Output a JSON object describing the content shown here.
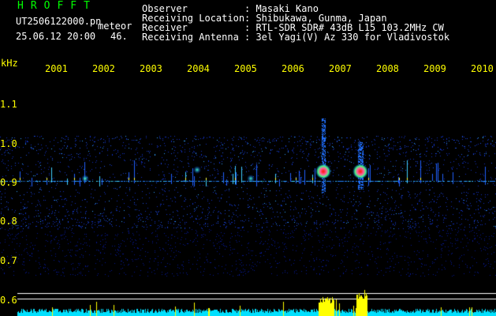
{
  "header": {
    "brand": "HROFFT",
    "filename": "UT2506122000.pn",
    "mode": "meteor",
    "datetime": "25.06.12 20:00",
    "count": "46.",
    "info": [
      {
        "label": "Observer",
        "value": ": Masaki Kano"
      },
      {
        "label": "Receiving Location",
        "value": ": Shibukawa, Gunma, Japan"
      },
      {
        "label": "Receiver",
        "value": ": RTL-SDR SDR# 43dB L15 103.2MHz CW"
      },
      {
        "label": "Receiving Antenna",
        "value": ": 3el Yagi(V) Az 330 for Vladivostok"
      }
    ]
  },
  "axis": {
    "unit": "kHz",
    "y_ticks": [
      "1.1",
      "1.0",
      "0.9",
      "0.8",
      "0.7",
      "0.6"
    ],
    "x_ticks": [
      "2001",
      "2002",
      "2003",
      "2004",
      "2005",
      "2006",
      "2007",
      "2008",
      "2009",
      "2010"
    ]
  },
  "colors": {
    "background": "#000000",
    "header_text": "#ffffff",
    "brand": "#00ff00",
    "axis_labels": "#ffff00",
    "noise_band": "#1030c0",
    "carrier_line": "#30c0ff",
    "echo_core": "#ff2020",
    "amplitude": "#00e0ff",
    "amplitude_peak": "#ffff00"
  },
  "events": [
    {
      "time_label": "2007",
      "type": "meteor-echo",
      "strength": "strong"
    },
    {
      "time_label": "2008",
      "type": "meteor-echo",
      "strength": "strong"
    }
  ]
}
